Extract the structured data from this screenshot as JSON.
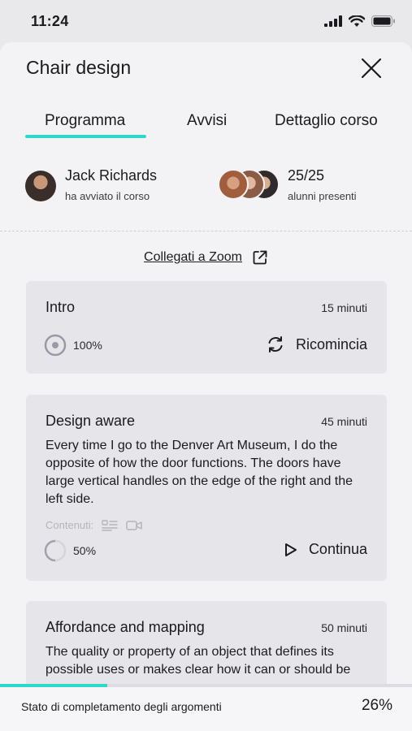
{
  "status_bar": {
    "time": "11:24"
  },
  "sheet": {
    "title": "Chair design"
  },
  "tabs": [
    {
      "label": "Programma",
      "active": true
    },
    {
      "label": "Avvisi",
      "active": false
    },
    {
      "label": "Dettaglio corso",
      "active": false
    }
  ],
  "teacher": {
    "name": "Jack Richards",
    "subtitle": "ha avviato il corso"
  },
  "attendance": {
    "value": "25/25",
    "subtitle": "alunni presenti"
  },
  "zoom": {
    "label": "Collegati a Zoom"
  },
  "lessons": [
    {
      "title": "Intro",
      "duration": "15 minuti",
      "progress": 100,
      "progress_label": "100%",
      "action": "Ricomincia"
    },
    {
      "title": "Design aware",
      "duration": "45 minuti",
      "description": "Every time I go to the Denver Art Museum, I do the opposite of how the door functions. The doors have large vertical handles on the edge of the right and the left side.",
      "contents_label": "Contenuti:",
      "progress": 50,
      "progress_label": "50%",
      "action": "Continua"
    },
    {
      "title": "Affordance and mapping",
      "duration": "50 minuti",
      "description": "The quality or property of an object that defines its possible uses or makes clear how it can or should be"
    }
  ],
  "completion": {
    "label": "Stato di completamento degli argomenti",
    "value_label": "26%",
    "value": 26
  },
  "colors": {
    "accent": "#2fd8c8",
    "card": "#e6e6ea",
    "sheet": "#f3f3f6"
  }
}
